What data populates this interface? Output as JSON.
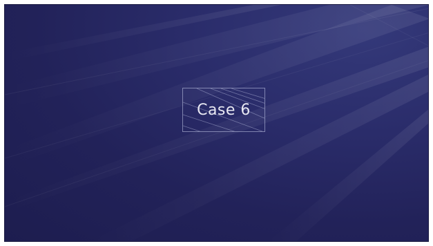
{
  "slide": {
    "title": "Case 6"
  },
  "colors": {
    "background": "#222259",
    "title_text": "#e8e8f2"
  }
}
